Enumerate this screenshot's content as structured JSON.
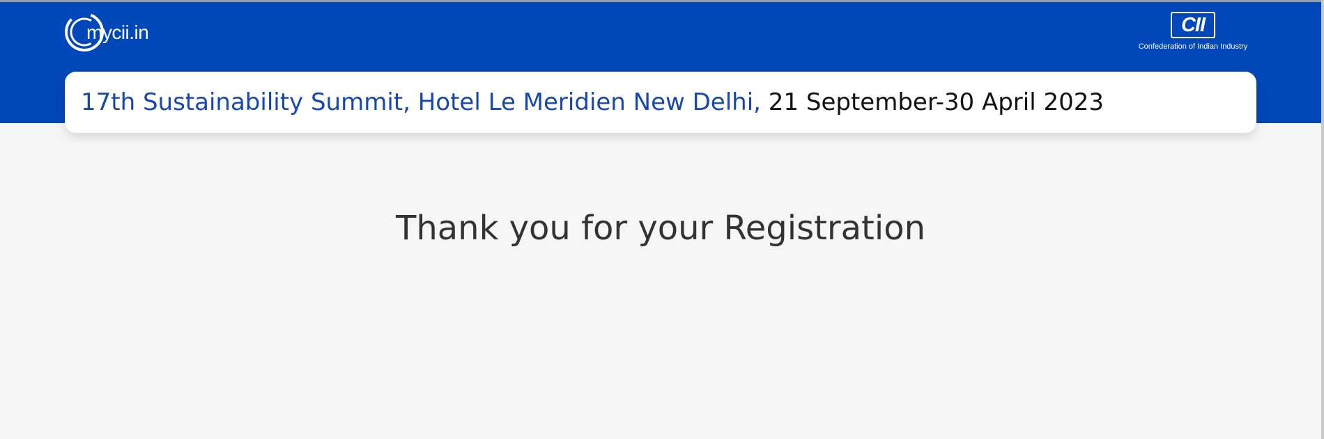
{
  "header": {
    "brand_logo_text": "mycii.in",
    "partner_logo_text": "CII",
    "partner_caption": "Confederation of Indian Industry",
    "background_color": "#0047ba"
  },
  "event": {
    "name": "17th Sustainability Summit, Hotel Le Meridien New Delhi",
    "separator": ",",
    "dates": "21 September-30 April 2023",
    "name_color": "#1747b0"
  },
  "main": {
    "message": "Thank you for your Registration"
  }
}
